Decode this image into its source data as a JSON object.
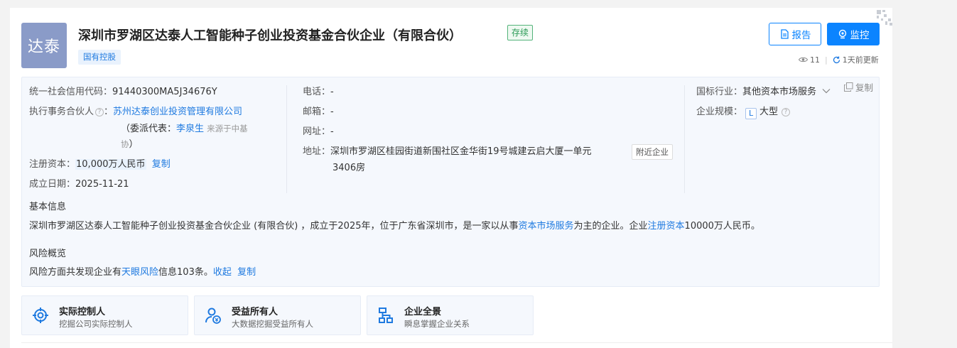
{
  "header": {
    "logo_text": "达泰",
    "company_name": "深圳市罗湖区达泰人工智能种子创业投资基金合伙企业（有限合伙）",
    "status": "存续",
    "tag": "国有控股",
    "report_button": "报告",
    "monitor_button": "监控",
    "views": "11",
    "updated": "1天前更新"
  },
  "info": {
    "credit_code_label": "统一社会信用代码：",
    "credit_code_value": "91440300MA5J34676Y",
    "partner_label": "执行事务合伙人",
    "partner_colon": "：",
    "partner_value": "苏州达泰创业投资管理有限公司",
    "delegate_prefix": "（委派代表：",
    "delegate_name": "李泉生",
    "delegate_source_1": "来源于中基",
    "delegate_source_2": "协",
    "delegate_suffix": "）",
    "capital_label": "注册资本：",
    "capital_value": "10,000万人民币",
    "capital_copy": "复制",
    "established_label": "成立日期：",
    "established_value": "2025-11-21",
    "phone_label": "电话：",
    "phone_value": "-",
    "email_label": "邮箱：",
    "email_value": "-",
    "website_label": "网址：",
    "website_value": "-",
    "address_label": "地址：",
    "address_line1": "深圳市罗湖区桂园街道新围社区金华街19号城建云启大厦一单元",
    "address_line2": "3406房",
    "nearby_button": "附近企业",
    "industry_label": "国标行业：",
    "industry_value": "其他资本市场服务",
    "scale_label": "企业规模：",
    "scale_letter": "L",
    "scale_value": "大型",
    "copy_all": "复制"
  },
  "basic": {
    "title": "基本信息",
    "text_1": "深圳市罗湖区达泰人工智能种子创业投资基金合伙企业 (有限合伙) ，成立于2025年，位于广东省深圳市，是一家以从事",
    "link_1": "资本市场服务",
    "text_2": "为主的企业。企业",
    "link_2": "注册资本",
    "text_3": "10000万人民币。"
  },
  "risk": {
    "title": "风险概览",
    "text_1": "风险方面共发现企业有",
    "link": "天眼风险",
    "text_2": "信息103条。",
    "collapse": "收起",
    "copy": "复制"
  },
  "features": [
    {
      "title": "实际控制人",
      "subtitle": "挖掘公司实际控制人",
      "icon": "target-icon"
    },
    {
      "title": "受益所有人",
      "subtitle": "大数据挖掘受益所有人",
      "icon": "beneficiary-icon"
    },
    {
      "title": "企业全景",
      "subtitle": "瞬息掌握企业关系",
      "icon": "org-chart-icon"
    }
  ],
  "colors": {
    "accent": "#0b84ff",
    "link": "#1f7ae0",
    "status_green": "#2a9a55",
    "logo_bg": "#8a9bc8",
    "panel_bg": "#f5f8fd"
  }
}
